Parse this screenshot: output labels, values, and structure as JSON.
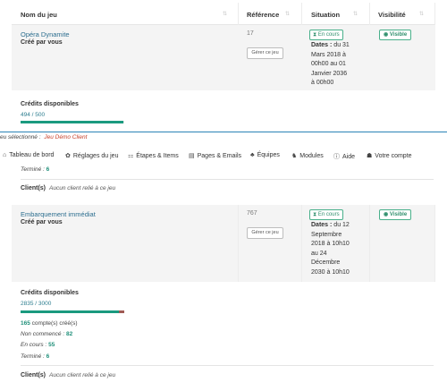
{
  "table": {
    "headers": {
      "name": "Nom du jeu",
      "reference": "Référence",
      "situation": "Situation",
      "visibility": "Visibilité"
    }
  },
  "rows": [
    {
      "name": "Opéra Dynamite",
      "created_prefix": "Créé par",
      "created_by": "vous",
      "reference": "17",
      "manage_label": "Gérer ce jeu",
      "status": "En cours",
      "dates_label": "Dates :",
      "dates_lines": [
        "du 31",
        "Mars 2018 à",
        "00h00 au 01",
        "Janvier 2036",
        "à 00h00"
      ],
      "visibility": "Visible",
      "credits_title": "Crédits disponibles",
      "credits_value": "494 / 500",
      "credits_fraction": 0.988
    },
    {
      "name": "Embarquement immédiat",
      "created_prefix": "Créé par",
      "created_by": "vous",
      "reference": "767",
      "manage_label": "Gérer ce jeu",
      "status": "En cours",
      "dates_label": "Dates :",
      "dates_lines": [
        "du 12",
        "Septembre",
        "2018 à 10h10",
        "au 24",
        "Décembre",
        "2030 à 10h10"
      ],
      "visibility": "Visible",
      "credits_title": "Crédits disponibles",
      "credits_value": "2835 / 3000",
      "credits_fraction": 0.945,
      "accounts_count": "165",
      "accounts_label": "compte(s) créé(s)",
      "not_started_label": "Non commencé :",
      "not_started_value": "82",
      "in_progress_label": "En cours :",
      "in_progress_value": "55",
      "finished_label": "Terminé :",
      "finished_value": "6",
      "clients_label": "Client(s)",
      "clients_text": "Aucun client relié à ce jeu"
    }
  ],
  "partial_above": {
    "finished_label": "Terminé :",
    "finished_value": "6",
    "clients_label": "Client(s)",
    "clients_text": "Aucun client relié à ce jeu"
  },
  "selected_game": {
    "label": "eu sélectionné :",
    "name": "Jeu Démo Client"
  },
  "navbar": {
    "items": [
      {
        "icon": "home-icon",
        "label": "Tableau de bord"
      },
      {
        "icon": "gear-icon",
        "label": "Réglages du jeu"
      },
      {
        "icon": "sitemap-icon",
        "label": "Étapes & Items"
      },
      {
        "icon": "document-icon",
        "label": "Pages & Emails"
      },
      {
        "icon": "users-icon",
        "label": "Équipes"
      },
      {
        "icon": "modules-icon",
        "label": "Modules"
      },
      {
        "icon": "info-icon",
        "label": "Aide"
      },
      {
        "icon": "account-icon",
        "label": "Votre compte"
      }
    ]
  },
  "colors": {
    "accent": "#1a9a7f",
    "link": "#2c6e8f",
    "selected_line": "#2b84b6",
    "selected_game": "#c7402a"
  }
}
